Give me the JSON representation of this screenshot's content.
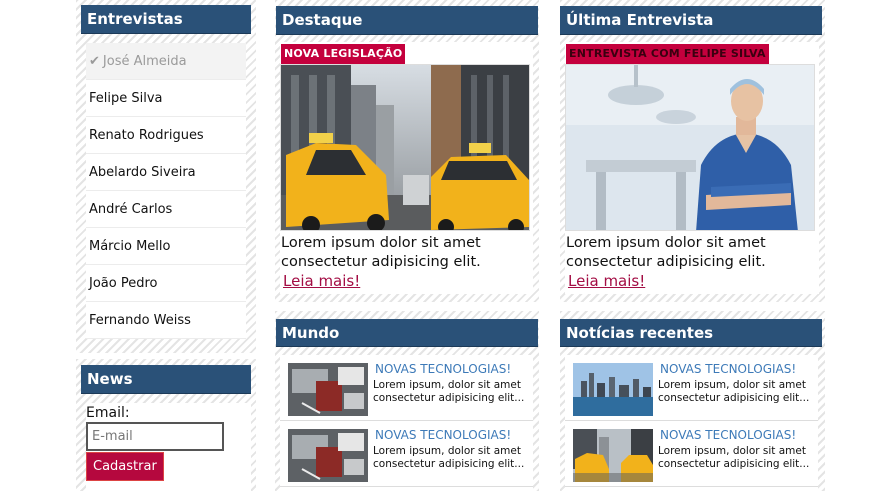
{
  "entrevistas": {
    "title": "Entrevistas",
    "items": [
      {
        "label": "José Almeida"
      },
      {
        "label": "Felipe Silva"
      },
      {
        "label": "Renato Rodrigues"
      },
      {
        "label": "Abelardo Siveira"
      },
      {
        "label": "André Carlos"
      },
      {
        "label": "Márcio Mello"
      },
      {
        "label": "João Pedro"
      },
      {
        "label": "Fernando Weiss"
      }
    ]
  },
  "news": {
    "title": "News",
    "email_label": "Email:",
    "email_placeholder": "E-mail",
    "submit_label": "Cadastrar"
  },
  "destaque": {
    "title": "Destaque",
    "tag": "NOVA LEGISLAÇÃO",
    "text": "Lorem ipsum dolor sit amet consectetur adipisicing elit.",
    "link": "Leia mais!"
  },
  "ultima": {
    "title": "Última Entrevista",
    "tag": "ENTREVISTA COM FELIPE SILVA",
    "text": "Lorem ipsum dolor sit amet consectetur adipisicing elit.",
    "link": "Leia mais!"
  },
  "mundo": {
    "title": "Mundo",
    "articles": [
      {
        "title": "NOVAS TECNOLOGIAS!",
        "desc": "Lorem ipsum, dolor sit amet consectetur adipisicing elit..."
      },
      {
        "title": "NOVAS TECNOLOGIAS!",
        "desc": "Lorem ipsum, dolor sit amet consectetur adipisicing elit..."
      }
    ]
  },
  "noticias": {
    "title": "Notícias recentes",
    "articles": [
      {
        "title": "NOVAS TECNOLOGIAS!",
        "desc": "Lorem ipsum, dolor sit amet consectetur adipisicing elit..."
      },
      {
        "title": "NOVAS TECNOLOGIAS!",
        "desc": "Lorem ipsum, dolor sit amet consectetur adipisicing elit..."
      }
    ]
  },
  "colors": {
    "header": "#2a5178",
    "accent": "#b5083e",
    "link": "#a30d44",
    "article_title": "#3d7ab8"
  },
  "icons": {
    "active_item": "check-icon"
  }
}
